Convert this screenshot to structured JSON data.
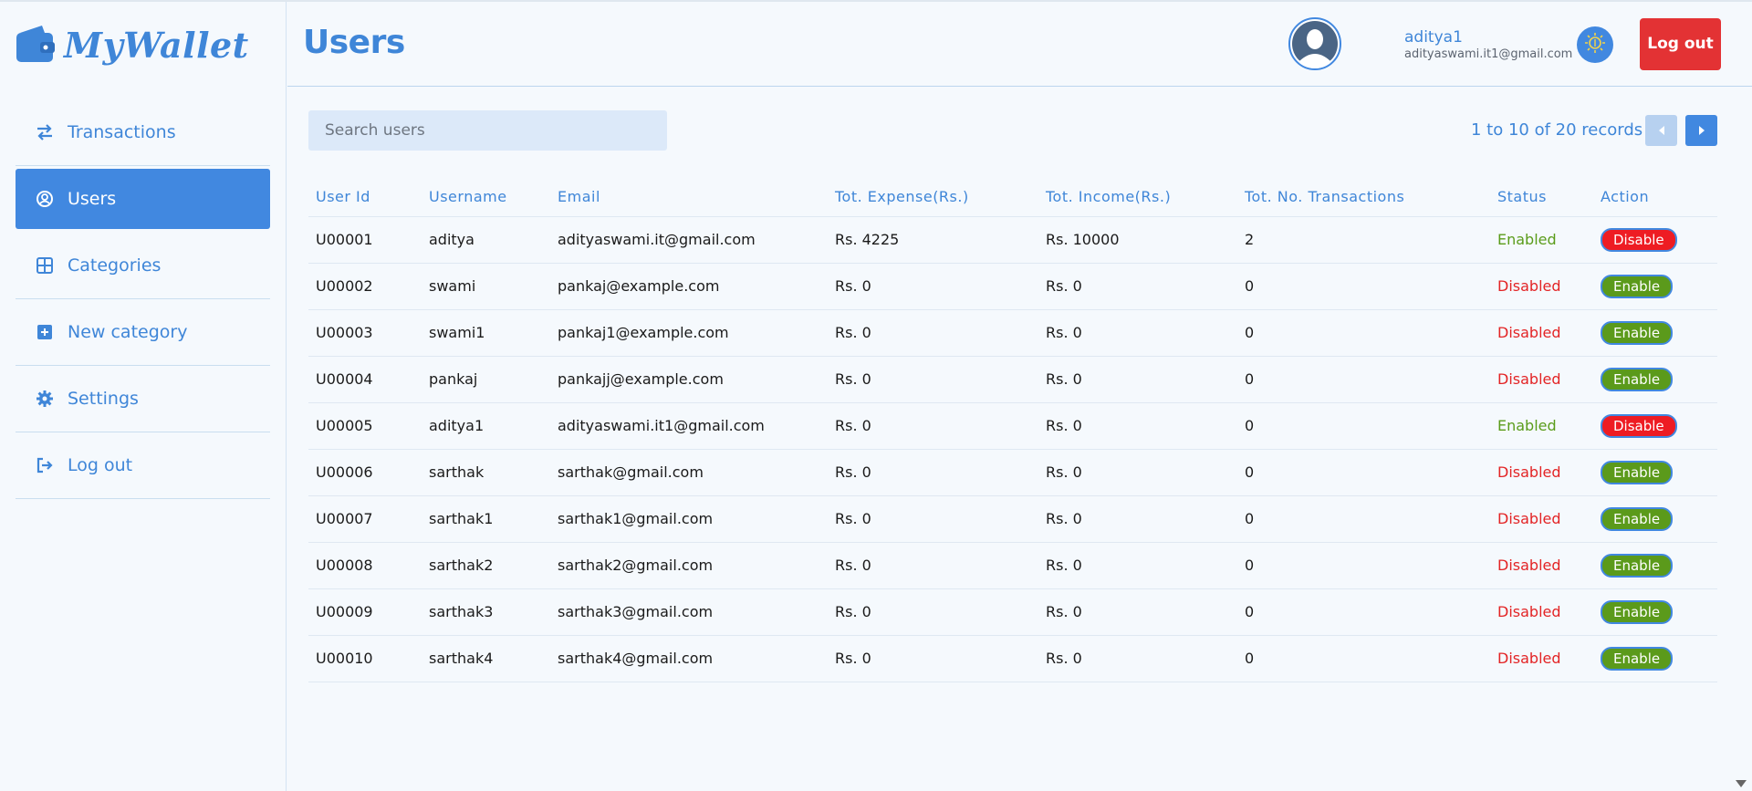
{
  "app": {
    "name": "MyWallet"
  },
  "sidebar": {
    "items": [
      {
        "label": "Transactions",
        "icon": "arrows-exchange-icon",
        "active": false
      },
      {
        "label": "Users",
        "icon": "user-circle-icon",
        "active": true
      },
      {
        "label": "Categories",
        "icon": "grid-icon",
        "active": false
      },
      {
        "label": "New category",
        "icon": "plus-square-icon",
        "active": false
      },
      {
        "label": "Settings",
        "icon": "gear-icon",
        "active": false
      },
      {
        "label": "Log out",
        "icon": "sign-out-icon",
        "active": false
      }
    ]
  },
  "header": {
    "title": "Users",
    "user_name": "aditya1",
    "user_email": "adityaswami.it1@gmail.com",
    "logout_label": "Log out"
  },
  "search": {
    "placeholder": "Search users"
  },
  "pagination": {
    "text": "1 to 10 of 20 records"
  },
  "table": {
    "columns": [
      "User Id",
      "Username",
      "Email",
      "Tot. Expense(Rs.)",
      "Tot. Income(Rs.)",
      "Tot. No. Transactions",
      "Status",
      "Action"
    ],
    "rows": [
      [
        "U00001",
        "aditya",
        "adityaswami.it@gmail.com",
        "Rs. 4225",
        "Rs. 10000",
        "2",
        "Enabled",
        "Disable"
      ],
      [
        "U00002",
        "swami",
        "pankaj@example.com",
        "Rs. 0",
        "Rs. 0",
        "0",
        "Disabled",
        "Enable"
      ],
      [
        "U00003",
        "swami1",
        "pankaj1@example.com",
        "Rs. 0",
        "Rs. 0",
        "0",
        "Disabled",
        "Enable"
      ],
      [
        "U00004",
        "pankaj",
        "pankajj@example.com",
        "Rs. 0",
        "Rs. 0",
        "0",
        "Disabled",
        "Enable"
      ],
      [
        "U00005",
        "aditya1",
        "adityaswami.it1@gmail.com",
        "Rs. 0",
        "Rs. 0",
        "0",
        "Enabled",
        "Disable"
      ],
      [
        "U00006",
        "sarthak",
        "sarthak@gmail.com",
        "Rs. 0",
        "Rs. 0",
        "0",
        "Disabled",
        "Enable"
      ],
      [
        "U00007",
        "sarthak1",
        "sarthak1@gmail.com",
        "Rs. 0",
        "Rs. 0",
        "0",
        "Disabled",
        "Enable"
      ],
      [
        "U00008",
        "sarthak2",
        "sarthak2@gmail.com",
        "Rs. 0",
        "Rs. 0",
        "0",
        "Disabled",
        "Enable"
      ],
      [
        "U00009",
        "sarthak3",
        "sarthak3@gmail.com",
        "Rs. 0",
        "Rs. 0",
        "0",
        "Disabled",
        "Enable"
      ],
      [
        "U00010",
        "sarthak4",
        "sarthak4@gmail.com",
        "Rs. 0",
        "Rs. 0",
        "0",
        "Disabled",
        "Enable"
      ]
    ]
  },
  "colors": {
    "accent": "#4188e0",
    "enabled": "#5a9c1a",
    "disabled": "#e32425",
    "logout": "#e33234"
  }
}
